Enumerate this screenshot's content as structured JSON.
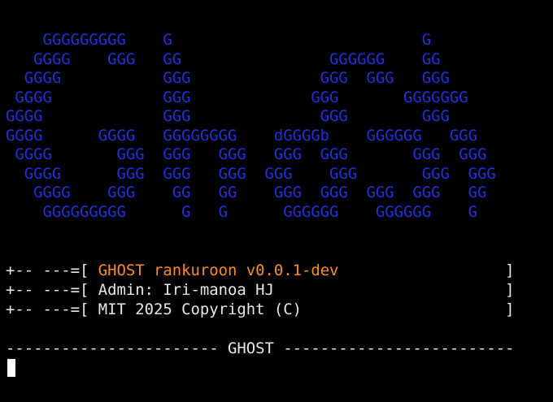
{
  "colors": {
    "background": "#000000",
    "banner": "#1f2fe0",
    "text": "#e6e6e6",
    "highlight": "#ff8a1e",
    "cursor": "#ffffff"
  },
  "banner": {
    "lines": [
      "    GGGGGGGGG    G                           G",
      "   GGGG    GGG   GG                GGGGGG    GG",
      "  GGGG           GGG              GGG  GGG   GGG",
      " GGGG            GGG             GGG       GGGGGGG",
      "GGGG             GGG              GGG        GGG",
      "GGGG      GGGG   GGGGGGGG    dGGGGb    GGGGGG   GGG",
      " GGGG       GGG  GGG   GGG   GGG  GGG       GGG  GGG",
      "  GGGG      GGG  GGG   GGG  GGG    GGG       GGG  GGG",
      "   GGGG    GGG    GG   GG    GGG  GGG  GGG  GGG   GG",
      "    GGGGGGGGG      G   G      GGGGGG    GGGGGG    G"
    ]
  },
  "info": {
    "line1": {
      "prefix": "+-- ---=[ ",
      "highlight": "GHOST rankuroon v0.0.1-dev",
      "suffix": "                  ]"
    },
    "line2": {
      "prefix": "+-- ---=[ ",
      "text": "Admin: Iri-manoa HJ",
      "suffix": "                         ]"
    },
    "line3": {
      "prefix": "+-- ---=[ ",
      "text": "MIT 2025 Copyright (C)",
      "suffix": "                      ]"
    }
  },
  "separator": "----------------------- GHOST -------------------------"
}
